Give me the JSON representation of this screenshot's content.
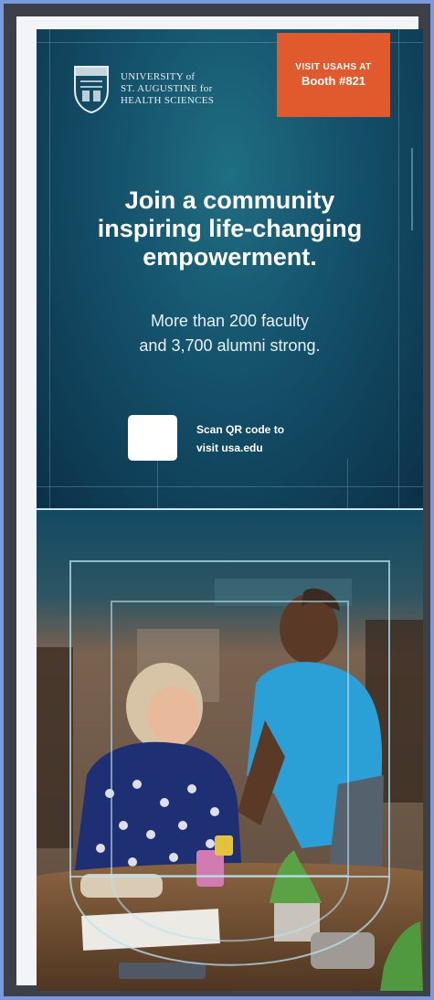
{
  "logo": {
    "line1": "UNIVERSITY of",
    "line2": "ST. AUGUSTINE for",
    "line3": "HEALTH SCIENCES"
  },
  "badge": {
    "line1": "VISIT USAHS AT",
    "line2": "Booth #821",
    "color": "#e05a2e"
  },
  "headline": {
    "line1": "Join a community",
    "line2": "inspiring life-changing",
    "line3": "empowerment."
  },
  "subhead": {
    "line1": "More than 200 faculty",
    "line2": "and 3,700 alumni strong."
  },
  "qr": {
    "line1": "Scan QR code to",
    "line2": "visit usa.edu"
  },
  "colors": {
    "panel_dark": "#0c3048",
    "panel_teal": "#1f6e82",
    "shirt_blue": "#2aa0d6"
  }
}
